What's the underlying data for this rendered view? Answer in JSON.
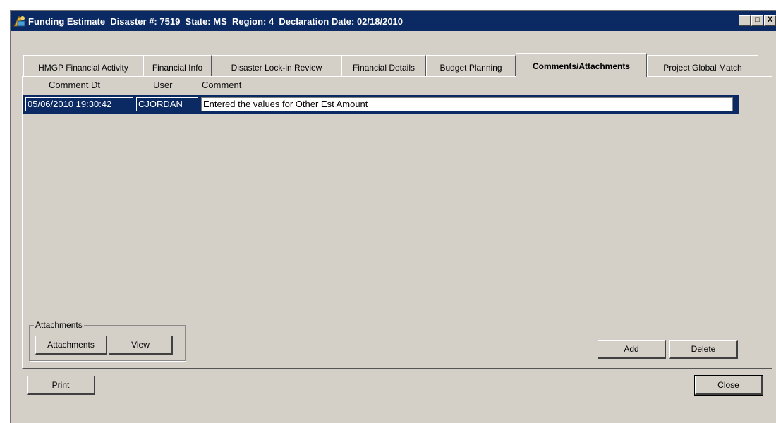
{
  "window": {
    "title": "Funding Estimate  Disaster #: 7519  State: MS  Region: 4  Declaration Date: 02/18/2010",
    "controls": [
      "_",
      "□",
      "X"
    ]
  },
  "tabs": [
    {
      "label": "HMGP Financial Activity",
      "active": false
    },
    {
      "label": "Financial Info",
      "active": false
    },
    {
      "label": "Disaster Lock-in Review",
      "active": false
    },
    {
      "label": "Financial Details",
      "active": false
    },
    {
      "label": "Budget Planning",
      "active": false
    },
    {
      "label": "Comments/Attachments",
      "active": true
    },
    {
      "label": "Project Global Match",
      "active": false
    }
  ],
  "grid": {
    "columns": [
      "Comment Dt",
      "User",
      "Comment"
    ],
    "rows": [
      {
        "date": "05/06/2010 19:30:42",
        "user": "CJORDAN",
        "comment": "Entered the values for Other Est Amount"
      }
    ]
  },
  "attachments_group": {
    "label": "Attachments",
    "attachments_button": "Attachments",
    "view_button": "View"
  },
  "actions": {
    "add": "Add",
    "delete": "Delete",
    "print": "Print",
    "close": "Close"
  },
  "colors": {
    "titlebar": "#0b2a64",
    "selection": "#0b2a64",
    "face": "#d4d0c8"
  }
}
